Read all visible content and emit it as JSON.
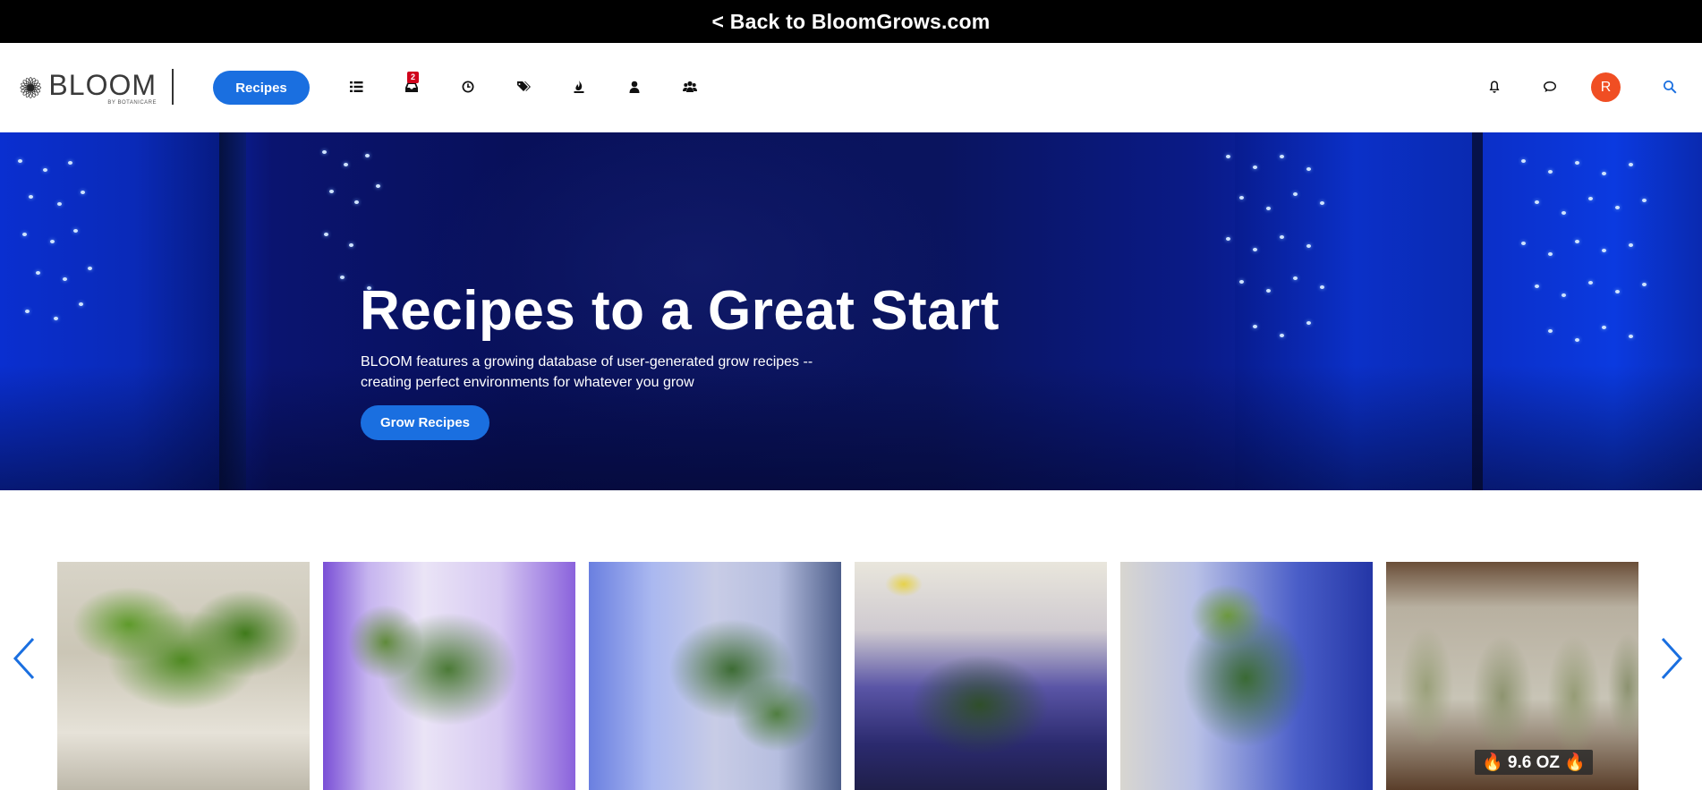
{
  "topbar": {
    "back_link": "< Back to BloomGrows.com"
  },
  "nav": {
    "logo_word": "BLOOM",
    "logo_sub": "BY BOTANICARE",
    "recipes_label": "Recipes",
    "icons": [
      "list-icon",
      "inbox-icon",
      "clock-icon",
      "tags-icon",
      "fire-icon",
      "user-icon",
      "users-icon"
    ],
    "inbox_badge": "2",
    "right_icons": [
      "bell-icon",
      "chat-icon",
      "search-icon"
    ],
    "avatar_initial": "R"
  },
  "hero": {
    "title": "Recipes to a Great Start",
    "description": "BLOOM features a growing database of user-generated grow recipes -- creating perfect environments for whatever you grow",
    "button_label": "Grow Recipes"
  },
  "carousel": {
    "cards": [
      {
        "overlay": ""
      },
      {
        "overlay": ""
      },
      {
        "overlay": ""
      },
      {
        "overlay": ""
      },
      {
        "overlay": ""
      },
      {
        "overlay": "🔥 9.6 OZ 🔥"
      }
    ]
  },
  "colors": {
    "accent": "#1a6fe0",
    "avatar": "#f04e23",
    "badge": "#d0021b"
  }
}
